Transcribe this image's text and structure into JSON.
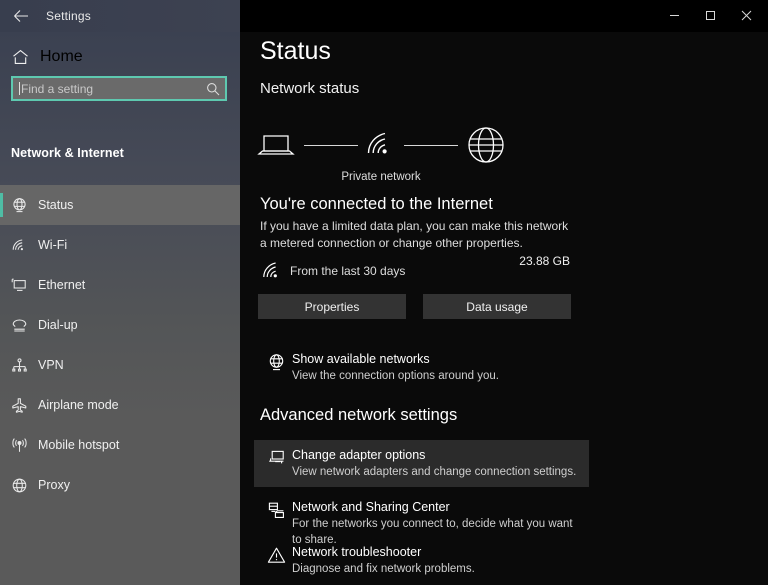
{
  "window": {
    "title": "Settings",
    "back_icon": "back-arrow-icon",
    "controls": {
      "minimize": "minimize-icon",
      "maximize": "maximize-icon",
      "close": "close-icon"
    }
  },
  "sidebar": {
    "home_label": "Home",
    "home_icon": "home-icon",
    "search": {
      "value": "",
      "placeholder": "Find a setting",
      "icon": "search-icon"
    },
    "category": "Network & Internet",
    "items": [
      {
        "label": "Status",
        "icon": "status-globe-icon",
        "selected": true
      },
      {
        "label": "Wi-Fi",
        "icon": "wifi-icon",
        "selected": false
      },
      {
        "label": "Ethernet",
        "icon": "ethernet-icon",
        "selected": false
      },
      {
        "label": "Dial-up",
        "icon": "dialup-icon",
        "selected": false
      },
      {
        "label": "VPN",
        "icon": "vpn-icon",
        "selected": false
      },
      {
        "label": "Airplane mode",
        "icon": "airplane-icon",
        "selected": false
      },
      {
        "label": "Mobile hotspot",
        "icon": "hotspot-icon",
        "selected": false
      },
      {
        "label": "Proxy",
        "icon": "proxy-globe-icon",
        "selected": false
      }
    ]
  },
  "main": {
    "page_title": "Status",
    "section_heading": "Network status",
    "diagram": {
      "device_icon": "laptop-icon",
      "link_icon": "wifi-signal-icon",
      "internet_icon": "globe-icon",
      "network_label": "Private network"
    },
    "connection": {
      "title": "You're connected to the Internet",
      "description": "If you have a limited data plan, you can make this network a metered connection or change other properties."
    },
    "data_usage": {
      "icon": "wifi-signal-icon",
      "period_label": "From the last 30 days",
      "amount": "23.88 GB"
    },
    "buttons": {
      "properties": "Properties",
      "data_usage": "Data usage"
    },
    "show_networks": {
      "icon": "status-globe-icon",
      "title": "Show available networks",
      "subtitle": "View the connection options around you."
    },
    "advanced_heading": "Advanced network settings",
    "advanced_items": [
      {
        "icon": "monitor-adapter-icon",
        "title": "Change adapter options",
        "subtitle": "View network adapters and change connection settings.",
        "highlighted": true
      },
      {
        "icon": "sharing-center-icon",
        "title": "Network and Sharing Center",
        "subtitle": "For the networks you connect to, decide what you want to share.",
        "highlighted": false
      },
      {
        "icon": "warning-triangle-icon",
        "title": "Network troubleshooter",
        "subtitle": "Diagnose and fix network problems.",
        "highlighted": false
      }
    ]
  },
  "colors": {
    "accent_teal": "#5ec9b0",
    "sidebar_gray": "#5a5a5a",
    "content_black": "#0a0a0a",
    "button_gray": "#333333",
    "highlight_gray": "#2b2b2b"
  }
}
